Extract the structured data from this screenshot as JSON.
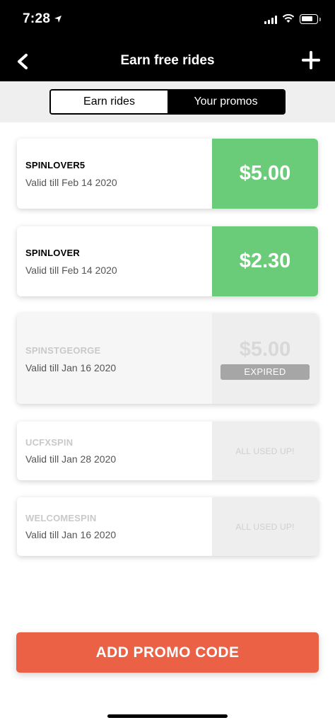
{
  "status_bar": {
    "time": "7:28"
  },
  "nav": {
    "title": "Earn free rides"
  },
  "tabs": [
    {
      "label": "Earn rides",
      "active": false
    },
    {
      "label": "Your promos",
      "active": true
    }
  ],
  "promos": [
    {
      "code": "SPINLOVER5",
      "valid": "Valid till Feb 14 2020",
      "amount": "$5.00",
      "state": "active"
    },
    {
      "code": "SPINLOVER",
      "valid": "Valid till Feb 14 2020",
      "amount": "$2.30",
      "state": "active"
    },
    {
      "code": "SPINSTGEORGE",
      "valid": "Valid till Jan 16 2020",
      "amount": "$5.00",
      "state": "expired",
      "badge": "EXPIRED"
    },
    {
      "code": "UCFXSPIN",
      "valid": "Valid till Jan 28 2020",
      "state": "used",
      "badge": "ALL USED UP!"
    },
    {
      "code": "WELCOMESPIN",
      "valid": "Valid till Jan 16 2020",
      "state": "used",
      "badge": "ALL USED UP!"
    }
  ],
  "add_button": {
    "label": "ADD PROMO CODE"
  },
  "colors": {
    "active_amount": "#6acc78",
    "add_button": "#ea6145",
    "header": "#000000"
  }
}
